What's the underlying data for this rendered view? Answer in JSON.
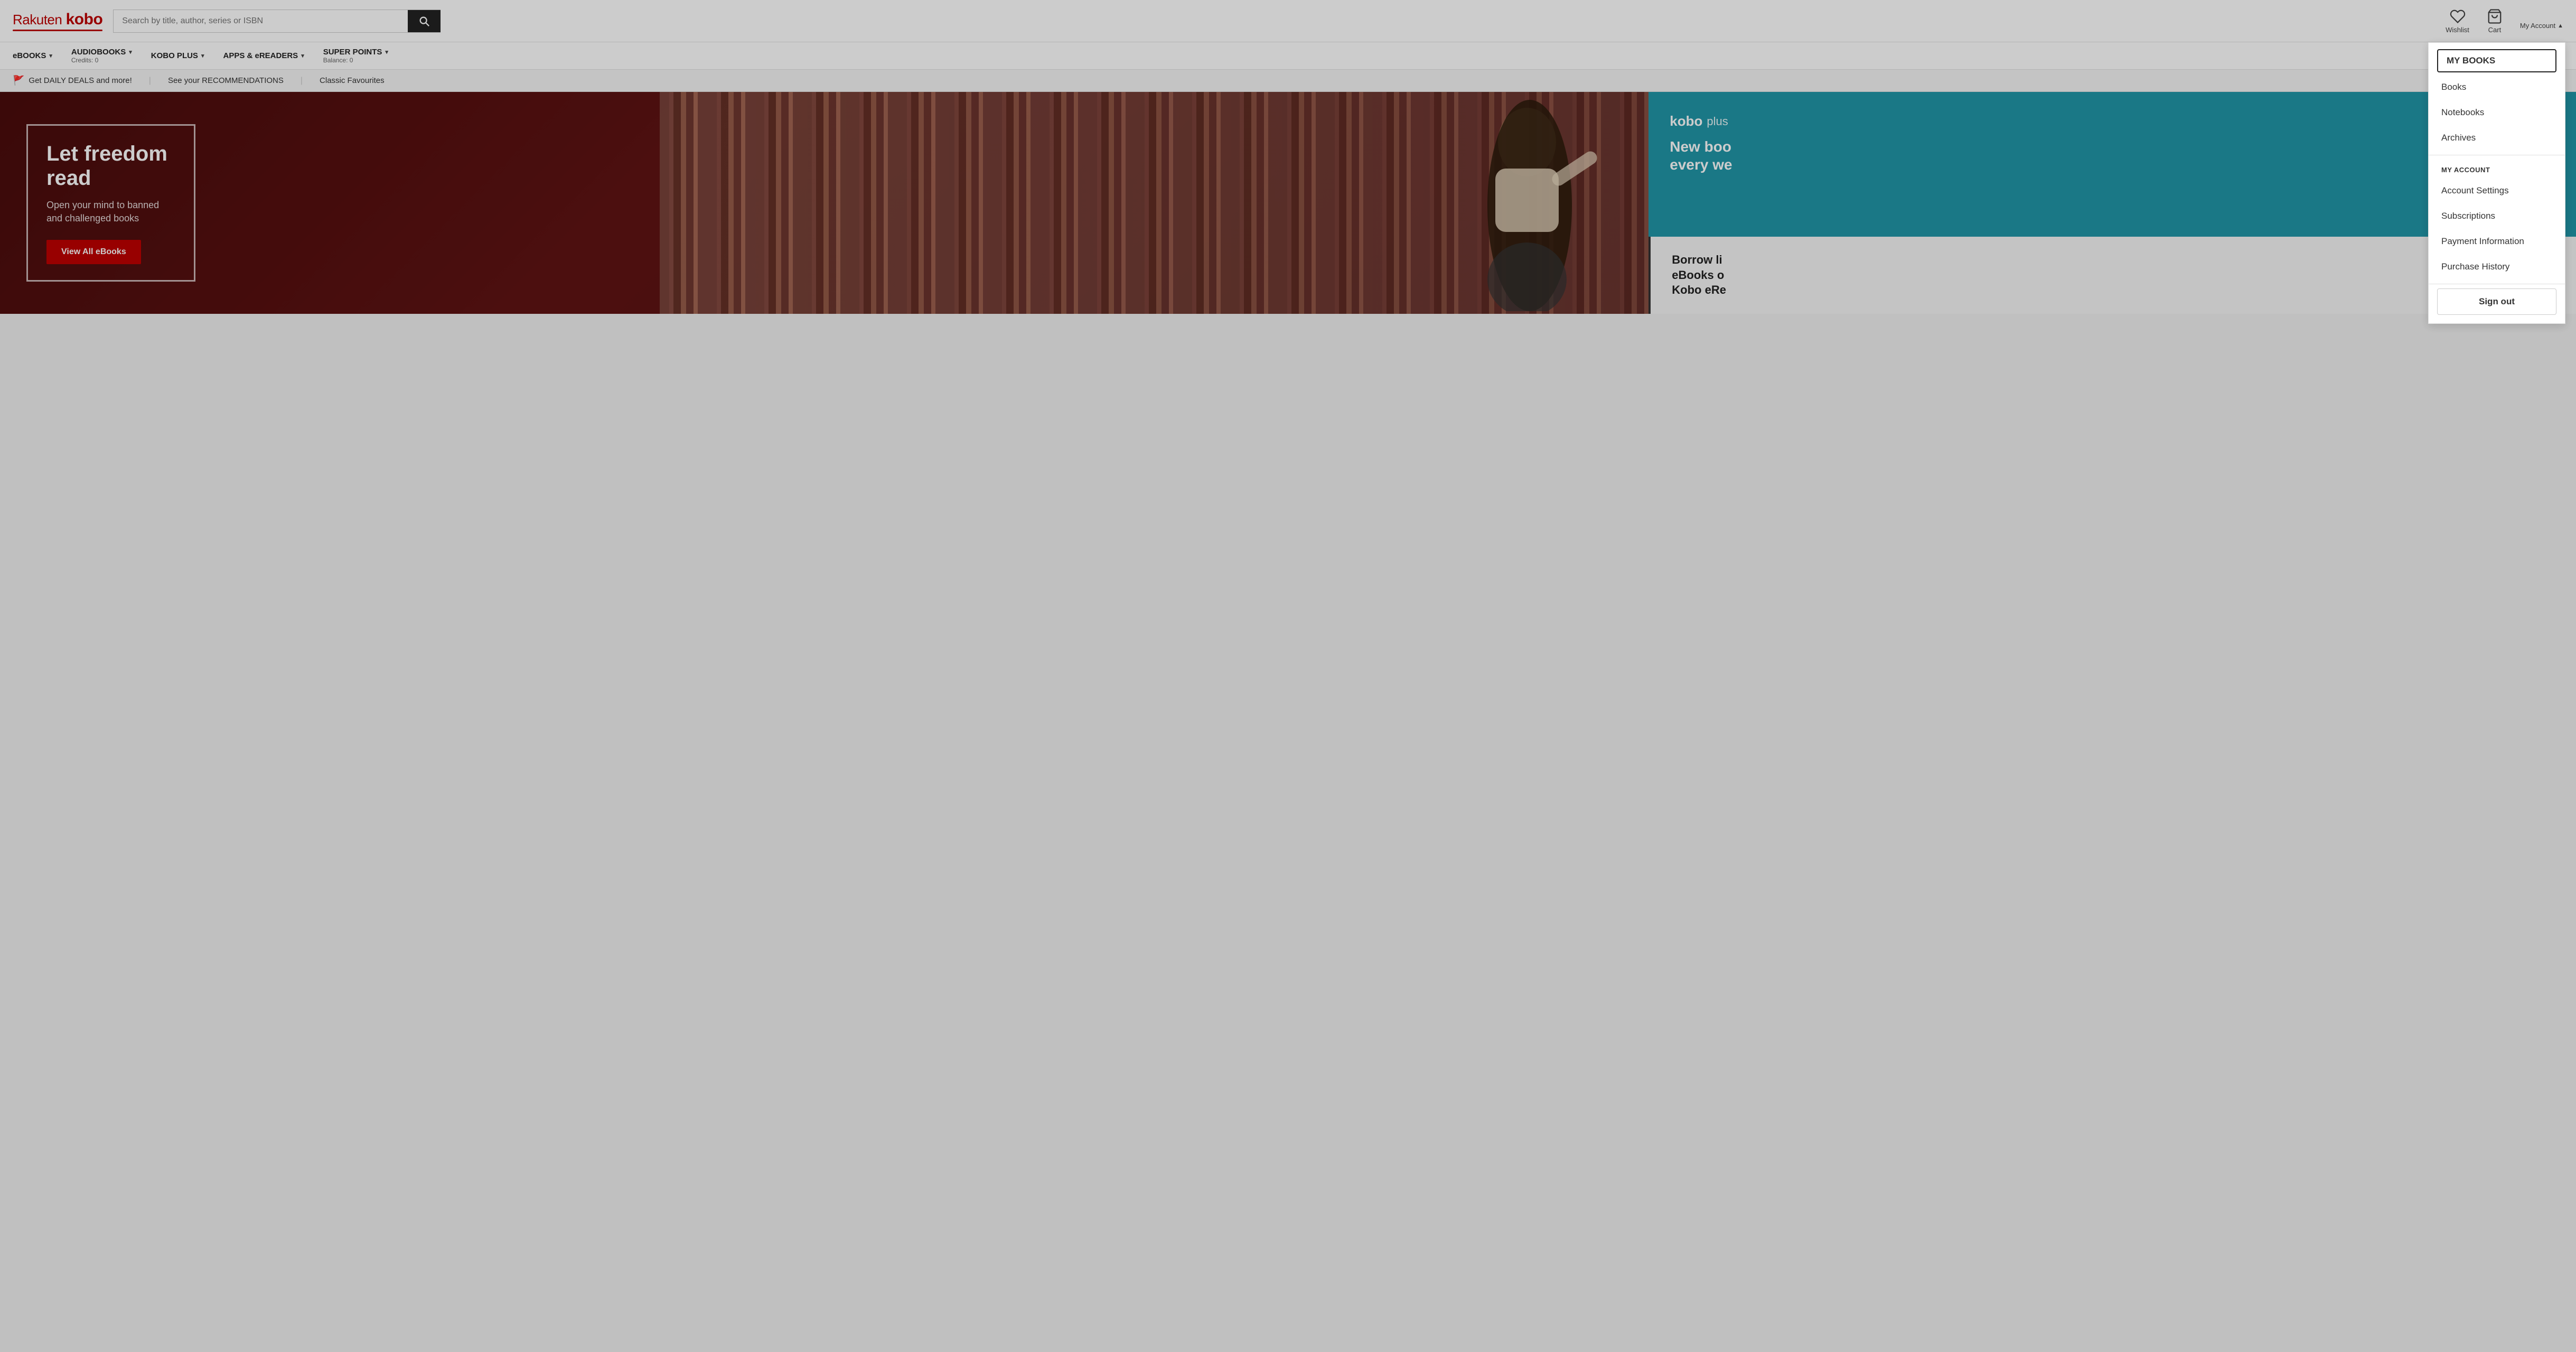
{
  "header": {
    "logo": "Rakuten kobo",
    "logo_rakuten": "Rakuten",
    "logo_kobo": "kobo",
    "search_placeholder": "Search by title, author, series or ISBN",
    "wishlist_label": "Wishlist",
    "cart_label": "Cart",
    "my_account_label": "My Account"
  },
  "nav": {
    "items": [
      {
        "label": "eBOOKS",
        "sub": "",
        "has_arrow": true
      },
      {
        "label": "AUDIOBOOKS",
        "sub": "Credits: 0",
        "has_arrow": true
      },
      {
        "label": "KOBO PLUS",
        "sub": "",
        "has_arrow": true
      },
      {
        "label": "APPS & eREADERS",
        "sub": "",
        "has_arrow": true
      },
      {
        "label": "SUPER POINTS",
        "sub": "Balance: 0",
        "has_arrow": true
      }
    ]
  },
  "promo_bar": {
    "items": [
      {
        "icon": "flag",
        "text": "Get DAILY DEALS and more!"
      },
      {
        "text": "See your RECOMMENDATIONS"
      },
      {
        "text": "Classic Favourites"
      }
    ]
  },
  "hero": {
    "title": "Let freedom read",
    "subtitle": "Open your mind to banned and challenged books",
    "button_label": "View All eBooks"
  },
  "kobo_plus": {
    "logo_kobo": "kobo",
    "logo_plus": "plus",
    "tagline_line1": "New boo",
    "tagline_line2": "every we"
  },
  "borrow_section": {
    "title_line1": "Borrow li",
    "title_line2": "eBooks o",
    "title_line3": "Kobo eRe"
  },
  "account_dropdown": {
    "my_books_section": "MY BOOKS",
    "my_books_active": "MY BOOKS",
    "books_label": "Books",
    "notebooks_label": "Notebooks",
    "archives_label": "Archives",
    "my_account_section": "MY ACCOUNT",
    "account_settings_label": "Account Settings",
    "subscriptions_label": "Subscriptions",
    "payment_information_label": "Payment Information",
    "purchase_history_label": "Purchase History",
    "sign_out_label": "Sign out"
  }
}
